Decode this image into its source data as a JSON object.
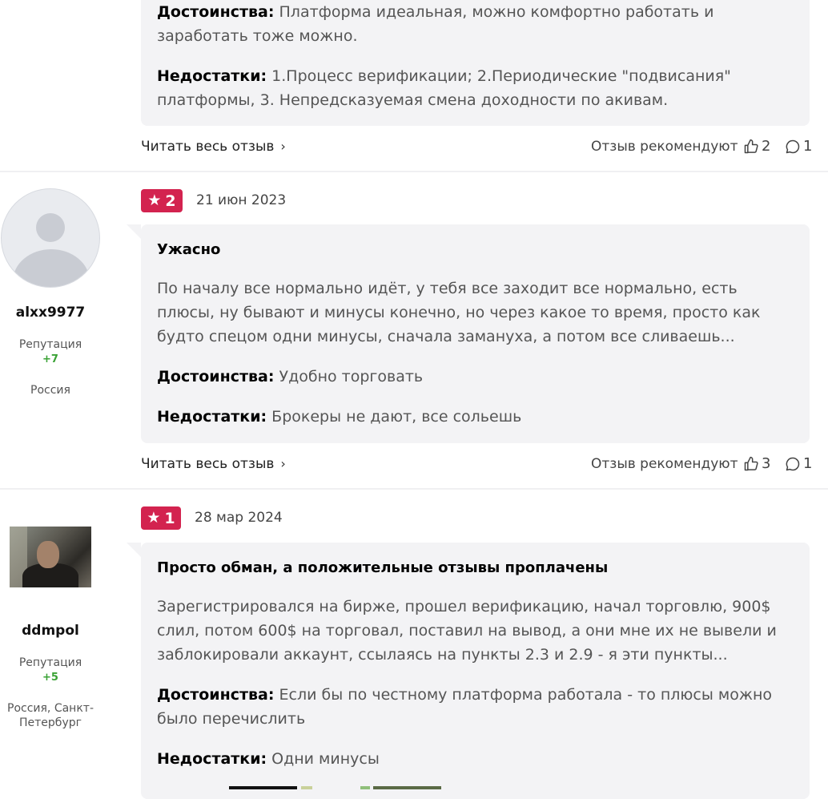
{
  "reviews": [
    {
      "pros_label": "Достоинства:",
      "pros_text": "Платформа идеальная, можно комфортно работать и заработать тоже можно.",
      "cons_label": "Недостатки:",
      "cons_text": "1.Процесс верификации; 2.Периодические \"подвисания\" платформы, 3. Непредсказуемая смена доходности по акивам.",
      "read_more": "Читать весь отзыв",
      "recommend_label": "Отзыв рекомендуют",
      "likes": "2",
      "comments": "1"
    },
    {
      "username": "alxx9977",
      "reputation_label": "Репутация",
      "reputation_value": "+7",
      "location": "Россия",
      "rating": "2",
      "date": "21 июн 2023",
      "title": "Ужасно",
      "body": "По началу все нормально идёт, у тебя все заходит все нормально, есть плюсы, ну бывают и минусы конечно, но через какое то время, просто как будто спецом одни минусы, сначала замануха, а потом все сливаешь...",
      "pros_label": "Достоинства:",
      "pros_text": "Удобно торговать",
      "cons_label": "Недостатки:",
      "cons_text": "Брокеры не дают, все сольешь",
      "read_more": "Читать весь отзыв",
      "recommend_label": "Отзыв рекомендуют",
      "likes": "3",
      "comments": "1"
    },
    {
      "username": "ddmpol",
      "reputation_label": "Репутация",
      "reputation_value": "+5",
      "location": "Россия, Санкт-Петербург",
      "rating": "1",
      "date": "28 мар 2024",
      "title": "Просто обман, а положительные отзывы проплачены",
      "body": "Зарегистрировался на бирже, прошел верификацию, начал торговлю, 900$ слил, потом 600$ на торговал, поставил на вывод, а они мне их не вывели и заблокировали аккаунт, ссылаясь на пункты 2.3 и 2.9 - я эти пункты...",
      "pros_label": "Достоинства:",
      "pros_text": "Если бы по честному платформа работала - то плюсы можно было перечислить",
      "cons_label": "Недостатки:",
      "cons_text": "Одни минусы"
    }
  ],
  "colors": {
    "badge": "#d3234f",
    "card_bg": "#f3f3f5",
    "reputation": "#3aa235"
  },
  "icons": [
    "star-icon",
    "chevron-right-icon",
    "thumbs-up-icon",
    "comment-icon",
    "default-avatar-icon"
  ]
}
